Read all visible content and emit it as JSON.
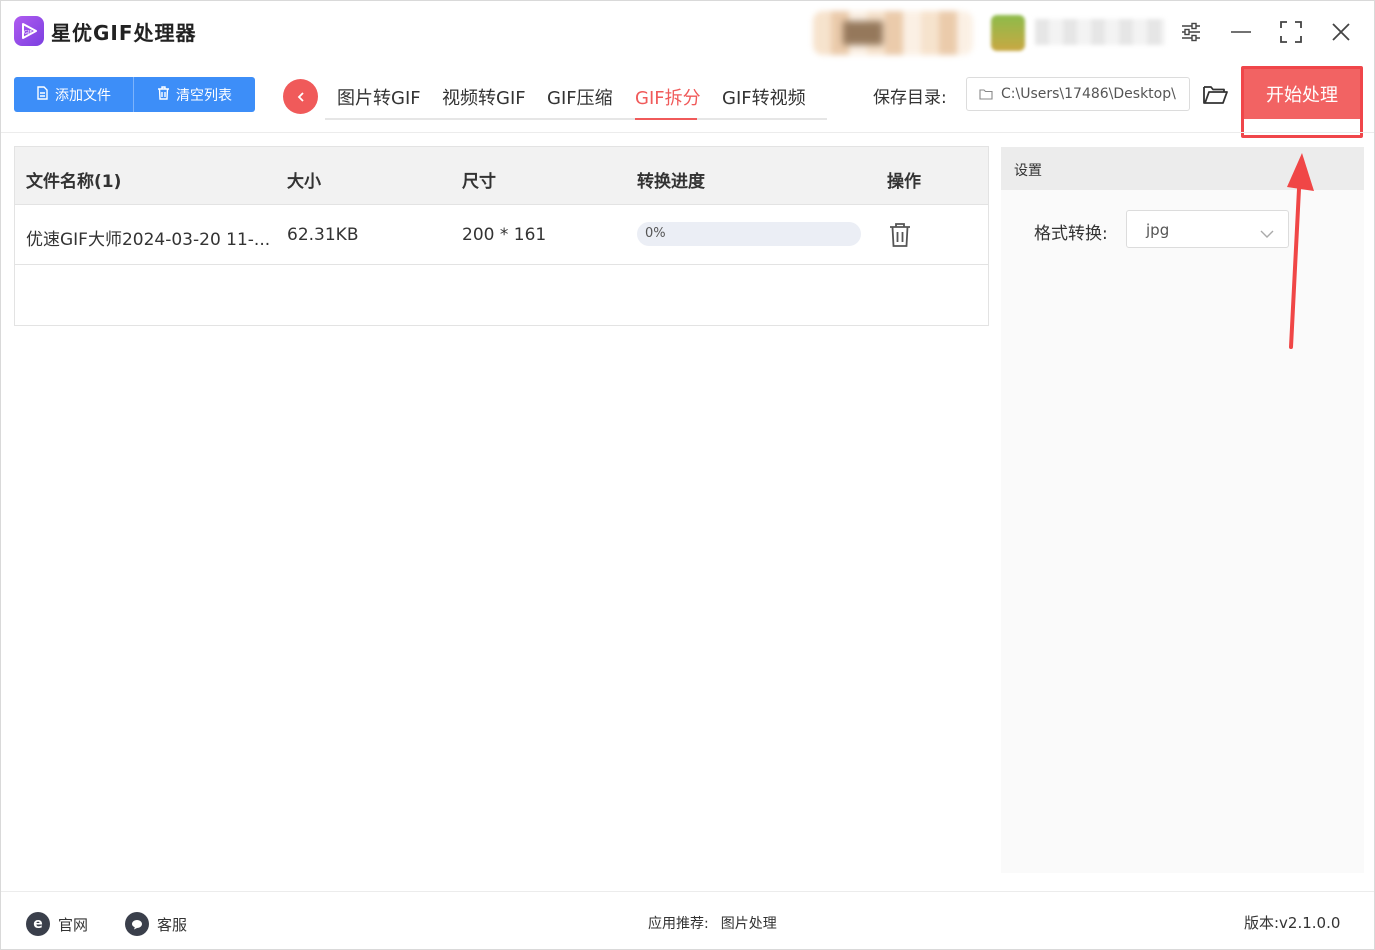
{
  "app": {
    "title": "星优GIF处理器"
  },
  "toolbar": {
    "add_file_label": "添加文件",
    "clear_list_label": "清空列表",
    "save_dir_label": "保存目录:",
    "save_dir_path": "C:\\Users\\17486\\Desktop\\",
    "start_label": "开始处理"
  },
  "tabs": [
    {
      "label": "图片转GIF",
      "active": false
    },
    {
      "label": "视频转GIF",
      "active": false
    },
    {
      "label": "GIF压缩",
      "active": false
    },
    {
      "label": "GIF拆分",
      "active": true
    },
    {
      "label": "GIF转视频",
      "active": false
    }
  ],
  "table": {
    "headers": [
      "文件名称(1)",
      "大小",
      "尺寸",
      "转换进度",
      "操作"
    ],
    "rows": [
      {
        "name": "优速GIF大师2024-03-20 11-...",
        "size": "62.31KB",
        "dimensions": "200 * 161",
        "progress_text": "0%",
        "progress": 0
      }
    ]
  },
  "settings": {
    "title": "设置",
    "format_label": "格式转换:",
    "format_value": "jpg"
  },
  "footer": {
    "website_label": "官网",
    "service_label": "客服",
    "recommend_label": "应用推荐:",
    "recommend_app": "图片处理",
    "version": "版本:v2.1.0.0"
  },
  "colors": {
    "accent_red": "#f26363",
    "primary_blue": "#3d8ef8",
    "logo_purple": "#9b4ef0"
  }
}
